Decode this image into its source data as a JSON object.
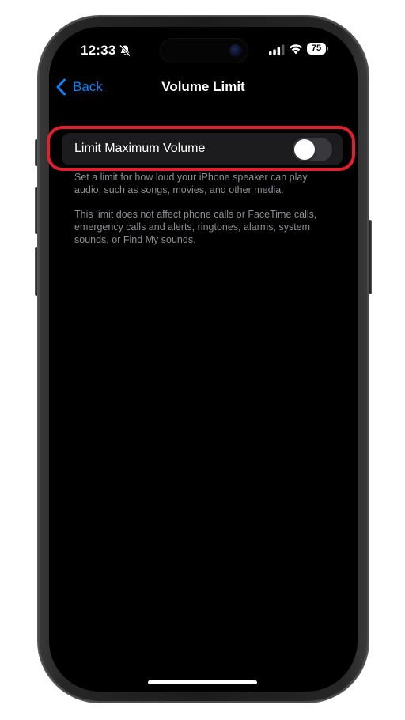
{
  "status_bar": {
    "time": "12:33",
    "battery": "75",
    "silent_icon": "bell-slash-icon",
    "signal_icon": "cellular-signal-icon",
    "wifi_icon": "wifi-icon"
  },
  "nav": {
    "back_label": "Back",
    "back_icon": "chevron-left-icon",
    "title": "Volume Limit"
  },
  "setting": {
    "label": "Limit Maximum Volume",
    "toggle_on": false
  },
  "footer": {
    "paragraph1": "Set a limit for how loud your iPhone speaker can play audio, such as songs, movies, and other media.",
    "paragraph2": "This limit does not affect phone calls or FaceTime calls, emergency calls and alerts, ringtones, alarms, system sounds, or Find My sounds."
  },
  "colors": {
    "accent": "#0a84ff",
    "highlight": "#e0202c",
    "background": "#000000",
    "row_background": "#1c1c1e",
    "secondary_text": "#8e8e93"
  }
}
